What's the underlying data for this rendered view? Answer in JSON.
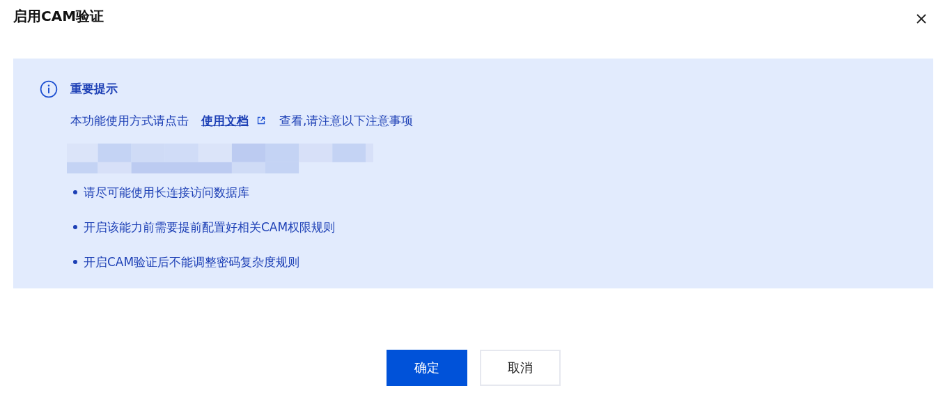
{
  "dialog": {
    "title": "启用CAM验证"
  },
  "notice": {
    "heading": "重要提示",
    "text_before": "本功能使用方式请点击",
    "link": "使用文档",
    "text_after": "查看,请注意以下注意事项",
    "items": [
      "请尽可能使用长连接访问数据库",
      "开启该能力前需要提前配置好相关CAM权限规则",
      "开启CAM验证后不能调整密码复杂度规则"
    ]
  },
  "buttons": [
    {
      "label": "确定",
      "kind": "primary"
    },
    {
      "label": "取消",
      "kind": "secondary"
    }
  ]
}
